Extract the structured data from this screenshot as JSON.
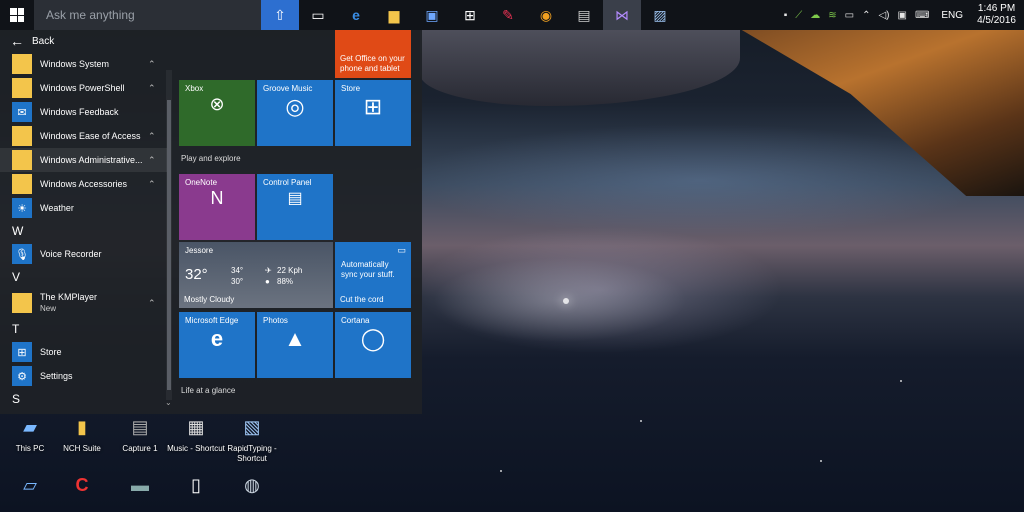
{
  "taskbar": {
    "search_placeholder": "Ask me anything",
    "icons": [
      "upload-icon",
      "task-view-icon",
      "edge-icon",
      "explorer-icon",
      "pf-icon",
      "store-icon",
      "paint-icon",
      "chrome-icon",
      "tool-icon",
      "media-icon",
      "photo-icon"
    ],
    "language": "ENG",
    "time": "1:46 PM",
    "date": "4/5/2016"
  },
  "start_menu": {
    "back_label": "Back",
    "apps": [
      {
        "label": "Windows System",
        "icon": "folder-icon",
        "has_chevron": true
      },
      {
        "label": "Windows PowerShell",
        "icon": "folder-icon",
        "has_chevron": true
      },
      {
        "label": "Windows Feedback",
        "icon": "feedback-icon",
        "has_chevron": false
      },
      {
        "label": "Windows Ease of Access",
        "icon": "folder-icon",
        "has_chevron": true
      },
      {
        "label": "Windows Administrative...",
        "icon": "folder-icon",
        "has_chevron": true
      },
      {
        "label": "Windows Accessories",
        "icon": "folder-icon",
        "has_chevron": true
      },
      {
        "label": "Weather",
        "icon": "weather-icon",
        "has_chevron": false
      }
    ],
    "letter_w": "W",
    "app_voice": "Voice Recorder",
    "letter_v": "V",
    "app_kmplayer": "The KMPlayer",
    "app_kmplayer_badge": "New",
    "letter_t": "T",
    "app_store": "Store",
    "app_settings": "Settings",
    "letter_s": "S"
  },
  "tiles": {
    "group_play": "Play and explore",
    "group_glance": "Life at a glance",
    "office": "Get Office on your phone and tablet",
    "xbox": "Xbox",
    "groove": "Groove Music",
    "store": "Store",
    "onenote": "OneNote",
    "control_panel": "Control Panel",
    "weather_city": "Jessore",
    "weather_temp": "32°",
    "weather_hi": "34°",
    "weather_lo": "30°",
    "weather_wind": "22 Kph",
    "weather_humidity": "88%",
    "weather_cond": "Mostly Cloudy",
    "cortana_tip_title": "Cut the cord",
    "cortana_tip_body": "Automatically sync your stuff.",
    "edge": "Microsoft Edge",
    "photos": "Photos",
    "cortana": "Cortana"
  },
  "desktop": {
    "row1": [
      "This PC",
      "NCH Suite",
      "Capture 1",
      "Music - Shortcut",
      "RapidTyping - Shortcut"
    ]
  }
}
